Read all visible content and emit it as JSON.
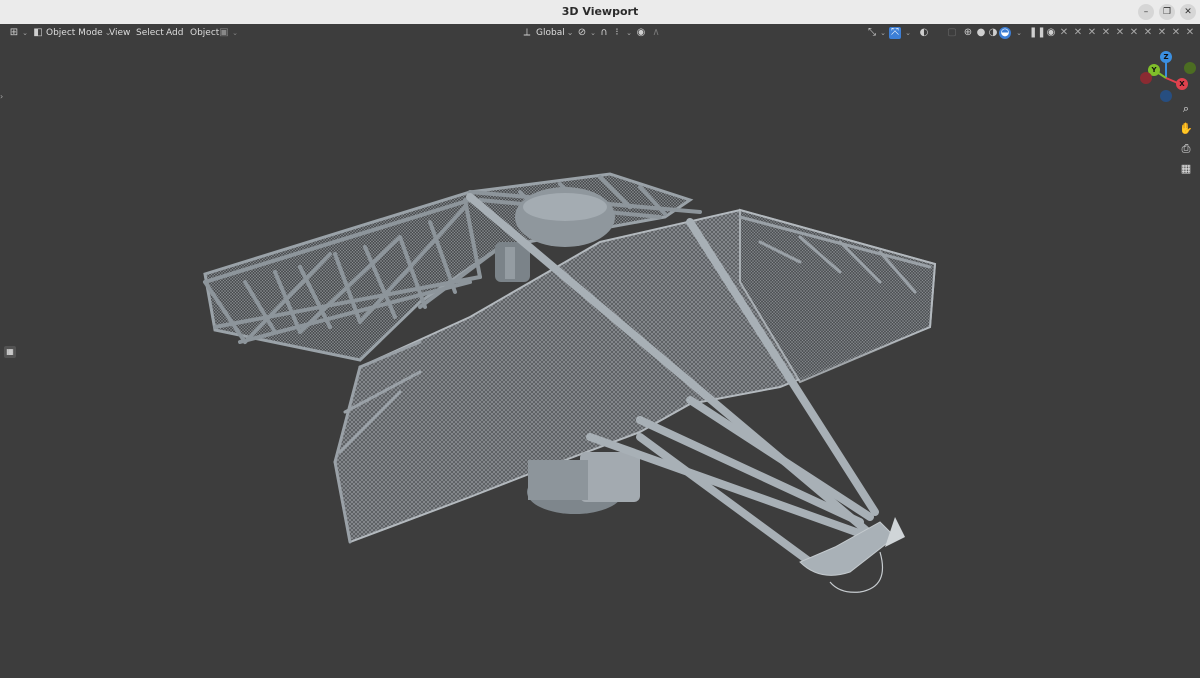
{
  "window": {
    "title": "3D Viewport",
    "controls": [
      "–",
      "❐",
      "✕"
    ]
  },
  "header": {
    "editor_type_icon": "editor-type-icon",
    "mode_label": "Object Mode",
    "menus": [
      "View",
      "Select",
      "Add",
      "Object"
    ],
    "transform_orientation": "Global",
    "icons": {
      "snap": "magnet-icon",
      "proportional": "proportional-edit-icon",
      "pivot": "pivot-icon",
      "gizmo": "gizmo-toggle-icon",
      "overlays": "overlay-icon",
      "xray": "xray-icon",
      "shading_wire": "wireframe-shading-icon",
      "shading_solid": "solid-shading-icon",
      "shading_material": "material-shading-icon",
      "shading_render": "render-shading-icon",
      "visibility": "eye-icon"
    }
  },
  "viewport": {
    "background": "#3d3d3d",
    "navigation": {
      "gizmo": {
        "x_label": "X",
        "y_label": "Y",
        "z_label": "Z",
        "x_color": "#e0414d",
        "y_color": "#7fbf2a",
        "z_color": "#3b8fe0"
      },
      "buttons": [
        "zoom-icon",
        "hand-pan-icon",
        "camera-icon",
        "grid-ortho-icon"
      ]
    },
    "object_description": "radar antenna model with mesh reflector"
  },
  "colors": {
    "accent": "#3d7fd6",
    "header_text": "#dcdcdc",
    "titlebar": "#ebebeb"
  }
}
